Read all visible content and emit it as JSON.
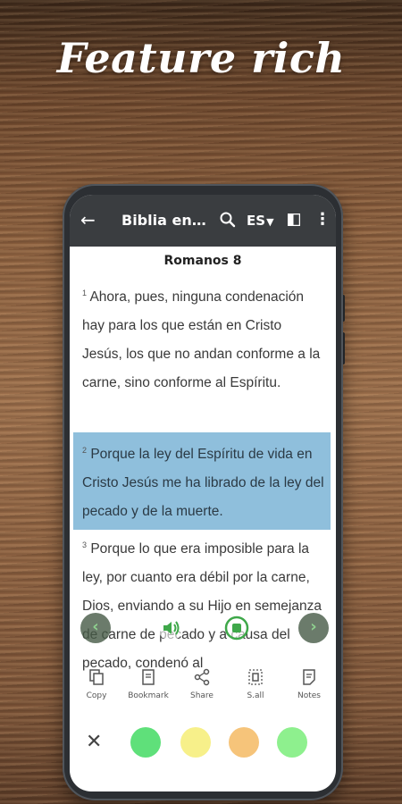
{
  "headline": "Feature rich",
  "appbar": {
    "back": "←",
    "title": "Biblia en…",
    "lang": "ES",
    "lang_caret": "▼",
    "more": "⋮"
  },
  "chapter": "Romanos 8",
  "verses": [
    {
      "num": "1",
      "text": "Ahora, pues, ninguna condenación hay para los que están en Cristo Jesús, los que no andan conforme a la carne, sino conforme al Espíritu."
    },
    {
      "num": "2",
      "text": "Porque la ley del Espíritu de vida en Cristo Jesús me ha librado de la ley del pecado y de la muerte."
    },
    {
      "num": "3",
      "text": "Porque lo que era imposible para la ley, por cuanto era débil por la carne, Dios, enviando a su Hijo en semejanza de carne de pecado y a causa del pecado, condenó al"
    }
  ],
  "nav": {
    "prev": "‹",
    "next": "›"
  },
  "toolbar": {
    "copy": "Copy",
    "bookmark": "Bookmark",
    "share": "Share",
    "select_all": "S.all",
    "notes": "Notes"
  },
  "close": "✕",
  "highlight_colors": [
    "#5fe07a",
    "#f7f08a",
    "#f6c47a",
    "#8ef08e"
  ],
  "colors": {
    "appbar": "#3a3d40",
    "highlight": "#8fbfdc"
  }
}
